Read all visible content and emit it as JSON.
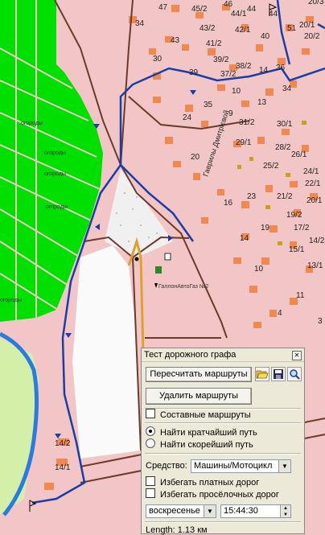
{
  "map": {
    "place_labels": [
      "огороды",
      "огороды",
      "огороды",
      "огороды",
      "огороды"
    ],
    "street_name": "Гаврилы Дмитрієвой",
    "gas_station_label": "ГаллонАвтоГаз №2",
    "house_numbers": [
      "47",
      "45/2",
      "46",
      "44/1",
      "44",
      "42/1",
      "43/2",
      "41/2",
      "40",
      "34",
      "43",
      "30",
      "39/2",
      "38/2",
      "36",
      "37/2",
      "39",
      "10",
      "14",
      "35",
      "13",
      "24",
      "31/2",
      "9",
      "30/1",
      "29/1",
      "28/2",
      "26/1",
      "20",
      "25/2",
      "24/1",
      "22/1",
      "23",
      "21/2",
      "16",
      "19/2",
      "20/1",
      "17/2",
      "19",
      "14",
      "14/2",
      "15/1",
      "10",
      "13/1",
      "11",
      "4",
      "14/2",
      "14/1",
      "3",
      "20/3",
      "20/1",
      "51",
      "44",
      "20/2",
      "34"
    ]
  },
  "panel": {
    "title": "Тест дорожного графа",
    "recalc_button": "Пересчитать маршруты",
    "delete_button": "Удалить маршруты",
    "composite_routes": "Составные маршруты",
    "find_shortest": "Найти кратчайший путь",
    "find_fastest": "Найти скорейший путь",
    "vehicle_label": "Средство:",
    "vehicle_value": "Машины/Мотоцикл",
    "avoid_toll": "Избегать платных дорог",
    "avoid_dirt": "Избегать просёлочных дорог",
    "day_value": "воскресенье",
    "time_value": "15:44:30",
    "length_text": "Length: 1.13 км",
    "icons": [
      "folder-open-icon",
      "save-icon",
      "search-icon"
    ]
  },
  "colors": {
    "background": "#f2c6c6",
    "garden": "#00e000",
    "building": "#f08850",
    "road_dark": "#6b3a2a",
    "route_blue": "#1a3da8",
    "water": "#2a7be0"
  }
}
